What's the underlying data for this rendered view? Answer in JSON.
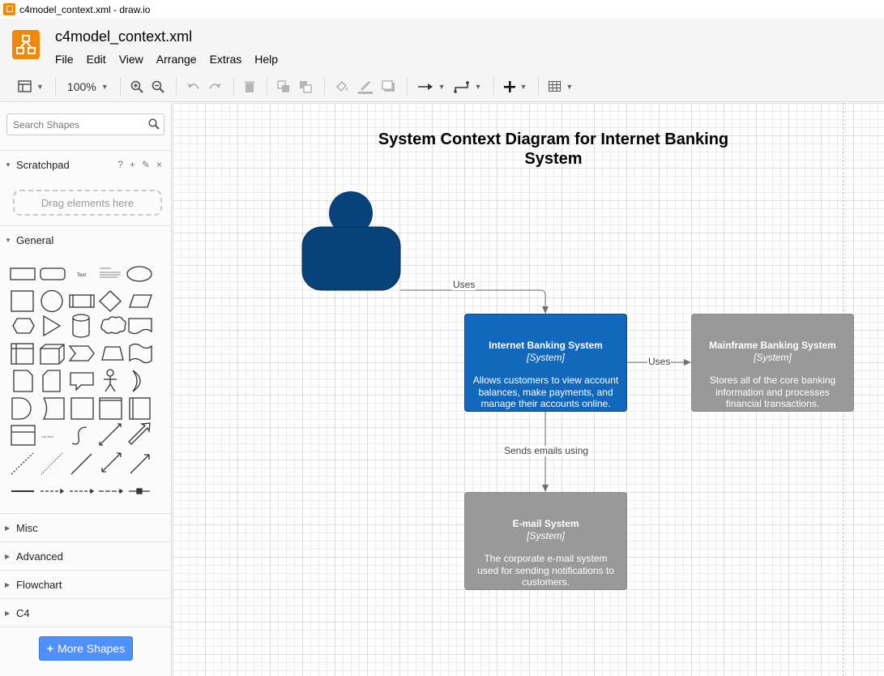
{
  "window": {
    "title": "c4model_context.xml - draw.io"
  },
  "header": {
    "filename": "c4model_context.xml",
    "menu": [
      "File",
      "Edit",
      "View",
      "Arrange",
      "Extras",
      "Help"
    ]
  },
  "toolbar": {
    "zoom": "100%",
    "icons": [
      "format-panel-icon",
      "zoom-in-icon",
      "zoom-out-icon",
      "undo-icon",
      "redo-icon",
      "delete-icon",
      "to-front-icon",
      "to-back-icon",
      "fill-color-icon",
      "line-color-icon",
      "shadow-icon",
      "connection-icon",
      "waypoints-icon",
      "insert-icon",
      "table-icon"
    ]
  },
  "sidebar": {
    "search_placeholder": "Search Shapes",
    "scratchpad": {
      "label": "Scratchpad",
      "drop_hint": "Drag elements here",
      "tools": [
        "?",
        "+",
        "✎",
        "×"
      ]
    },
    "general": "General",
    "sections": [
      "Misc",
      "Advanced",
      "Flowchart",
      "C4"
    ],
    "more_shapes": "More Shapes"
  },
  "diagram": {
    "title": "System Context Diagram for Internet Banking System",
    "nodes": [
      {
        "name": "Internet Banking System",
        "type": "[System]",
        "description": "Allows customers to view account balances, make payments, and manage their accounts online.",
        "color": "#1168bd"
      },
      {
        "name": "Mainframe Banking System",
        "type": "[System]",
        "description": "Stores all of the core banking information and processes financial transactions.",
        "color": "#999999"
      },
      {
        "name": "E-mail System",
        "type": "[System]",
        "description": "The corporate e-mail system used for sending notifications to customers.",
        "color": "#999999"
      }
    ],
    "person_color": "#08427b",
    "edges": [
      {
        "label": "Uses"
      },
      {
        "label": "Uses"
      },
      {
        "label": "Sends emails using"
      }
    ]
  }
}
